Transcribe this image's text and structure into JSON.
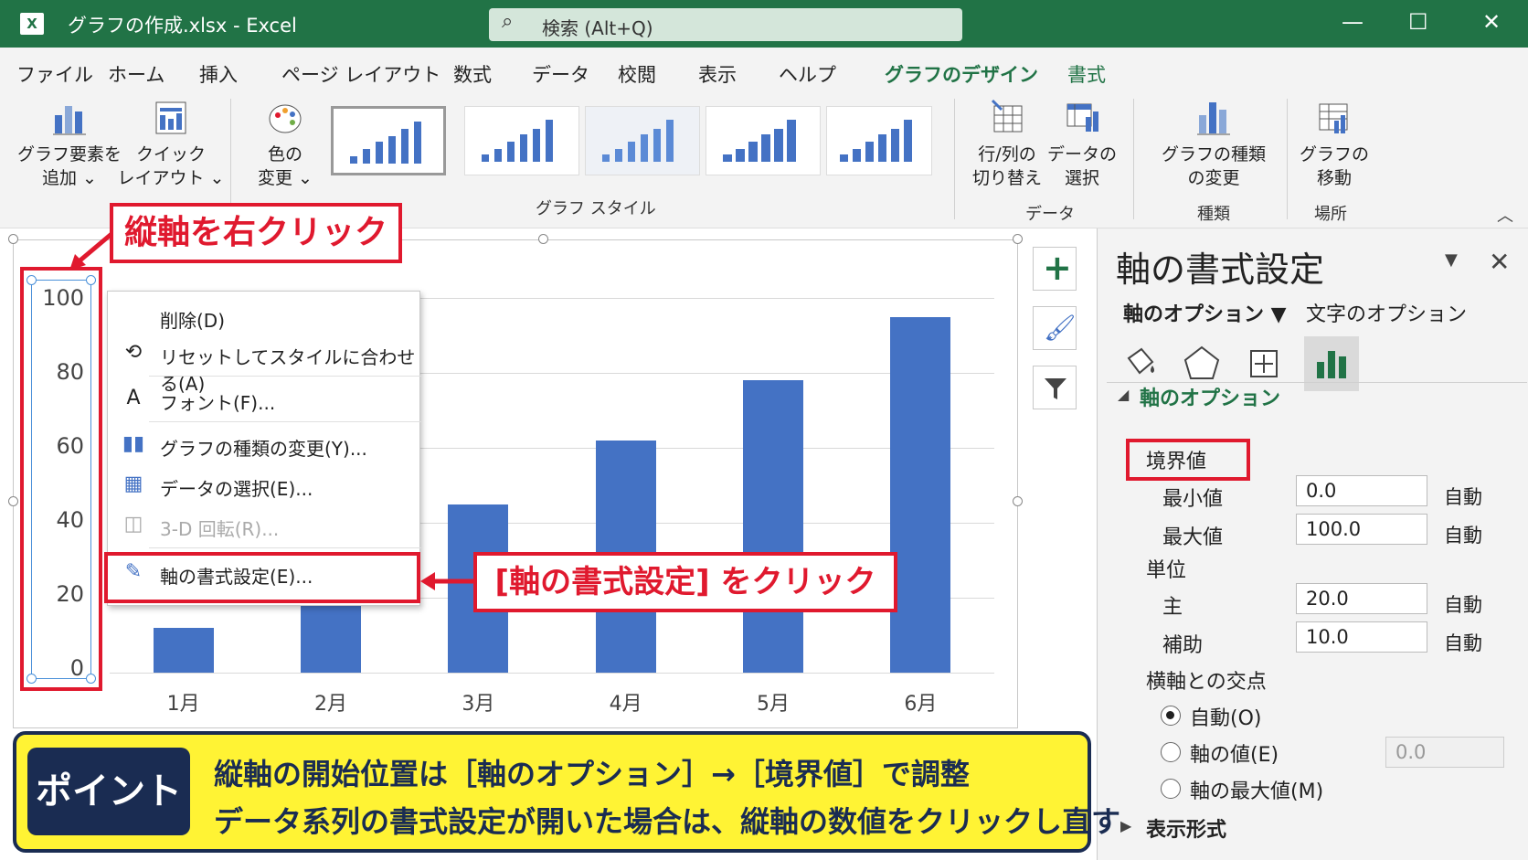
{
  "window": {
    "title": "グラフの作成.xlsx  -  Excel",
    "app_icon": "X",
    "search_placeholder": "検索 (Alt+Q)"
  },
  "tabs": [
    "ファイル",
    "ホーム",
    "挿入",
    "ページ レイアウト",
    "数式",
    "データ",
    "校閲",
    "表示",
    "ヘルプ",
    "グラフのデザイン",
    "書式"
  ],
  "active_tab": "グラフのデザイン",
  "ribbon": {
    "add_element": [
      "グラフ要素を",
      "追加 ⌄"
    ],
    "quick_layout": [
      "クイック",
      "レイアウト ⌄"
    ],
    "change_colors": [
      "色の",
      "変更 ⌄"
    ],
    "chart_styles_group": "グラフ スタイル",
    "switch_row_col": [
      "行/列の",
      "切り替え"
    ],
    "select_data": [
      "データの",
      "選択"
    ],
    "data_group": "データ",
    "change_type": [
      "グラフの種類",
      "の変更"
    ],
    "type_group": "種類",
    "move_chart": [
      "グラフの",
      "移動"
    ],
    "location_group": "場所"
  },
  "chart_data": {
    "type": "bar",
    "categories": [
      "1月",
      "2月",
      "3月",
      "4月",
      "5月",
      "6月"
    ],
    "values": [
      12,
      32,
      45,
      62,
      78,
      95
    ],
    "yticks": [
      "100",
      "80",
      "60",
      "40",
      "20",
      "0"
    ],
    "ylim": [
      0,
      100
    ],
    "grid": true,
    "bar_color": "#4472c4"
  },
  "context_menu": {
    "delete": "削除(D)",
    "reset": "リセットしてスタイルに合わせる(A)",
    "font": "フォント(F)...",
    "change_type": "グラフの種類の変更(Y)...",
    "select_data": "データの選択(E)...",
    "rotation": "3-D 回転(R)...",
    "format_axis": "軸の書式設定(E)..."
  },
  "callouts": {
    "axis": "縦軸を右クリック",
    "format": "[軸の書式設定] をクリック"
  },
  "pane": {
    "title": "軸の書式設定",
    "tab_axis": "軸のオプション ▼",
    "tab_text": "文字のオプション",
    "section": "軸のオプション",
    "bounds": "境界値",
    "min_label": "最小値",
    "min_value": "0.0",
    "max_label": "最大値",
    "max_value": "100.0",
    "units": "単位",
    "major_label": "主",
    "major_value": "20.0",
    "minor_label": "補助",
    "minor_value": "10.0",
    "auto": "自動",
    "crosses": "横軸との交点",
    "radio_auto": "自動(O)",
    "radio_value": "軸の値(E)",
    "radio_value_input": "0.0",
    "radio_max": "軸の最大値(M)",
    "display_format": "表示形式"
  },
  "point": {
    "badge": "ポイント",
    "line1": "縦軸の開始位置は［軸のオプション］→［境界値］で調整",
    "line2": "データ系列の書式設定が開いた場合は、縦軸の数値をクリックし直す"
  },
  "colors": {
    "excel_green": "#217346",
    "accent_red": "#e0192e",
    "point_bg": "#fff334",
    "point_dark": "#1a2c52"
  }
}
